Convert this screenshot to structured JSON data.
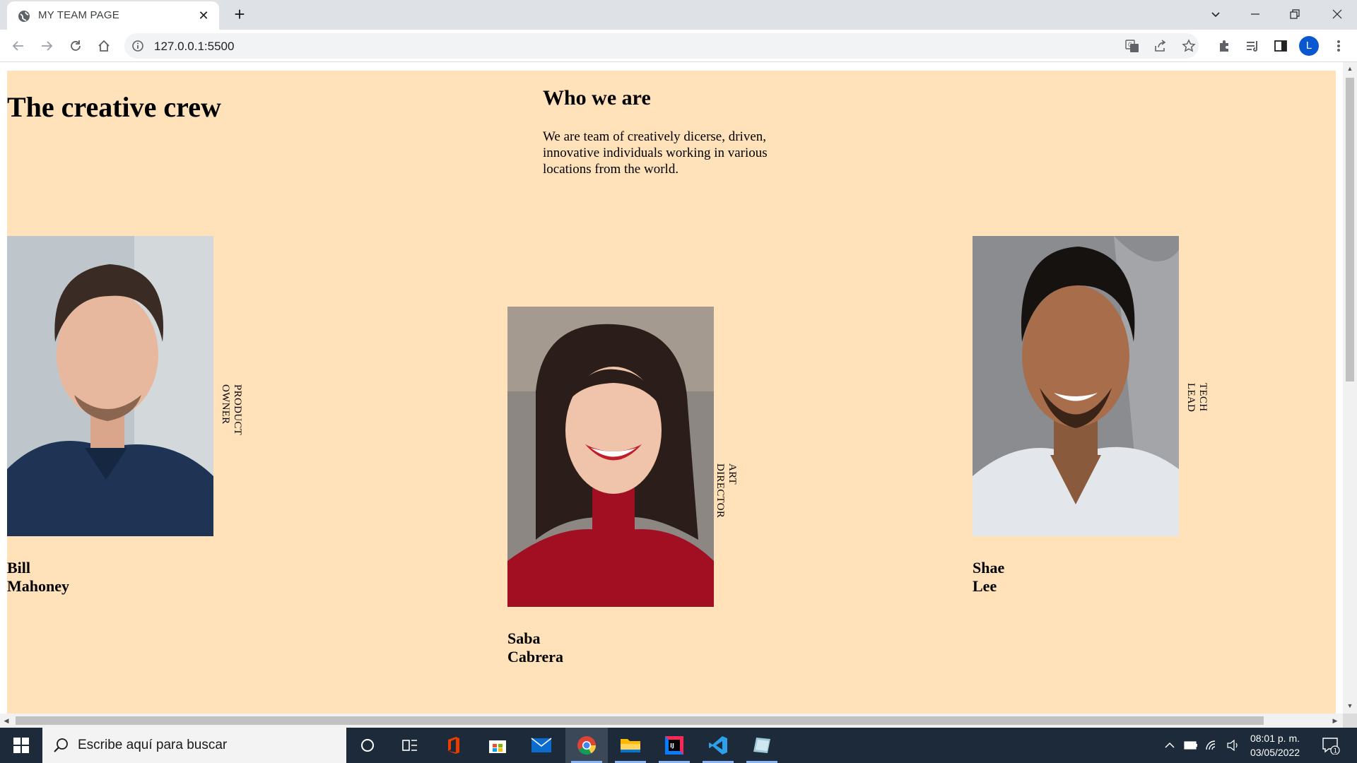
{
  "browser": {
    "tab_title": "MY TEAM PAGE",
    "url": "127.0.0.1:5500",
    "profile_initial": "L"
  },
  "page": {
    "heading": "The creative crew",
    "about_title": "Who we are",
    "about_text": "We are team of creatively dicerse, driven, innovative individuals working in various locations from the world.",
    "background": "#ffe1ba",
    "members": [
      {
        "name": "Bill Mahoney",
        "role": "PRODUCT OWNER"
      },
      {
        "name": "Saba Cabrera",
        "role": "ART DIRECTOR"
      },
      {
        "name": "Shae Lee",
        "role": "TECH LEAD"
      }
    ]
  },
  "taskbar": {
    "search_placeholder": "Escribe aquí para buscar",
    "time": "08:01 p. m.",
    "date": "03/05/2022",
    "notification_count": "1",
    "apps": [
      "cortana-icon",
      "task-view-icon",
      "office-icon",
      "store-icon",
      "mail-icon",
      "chrome-icon",
      "file-explorer-icon",
      "intellij-icon",
      "vscode-icon",
      "notes-icon"
    ]
  }
}
